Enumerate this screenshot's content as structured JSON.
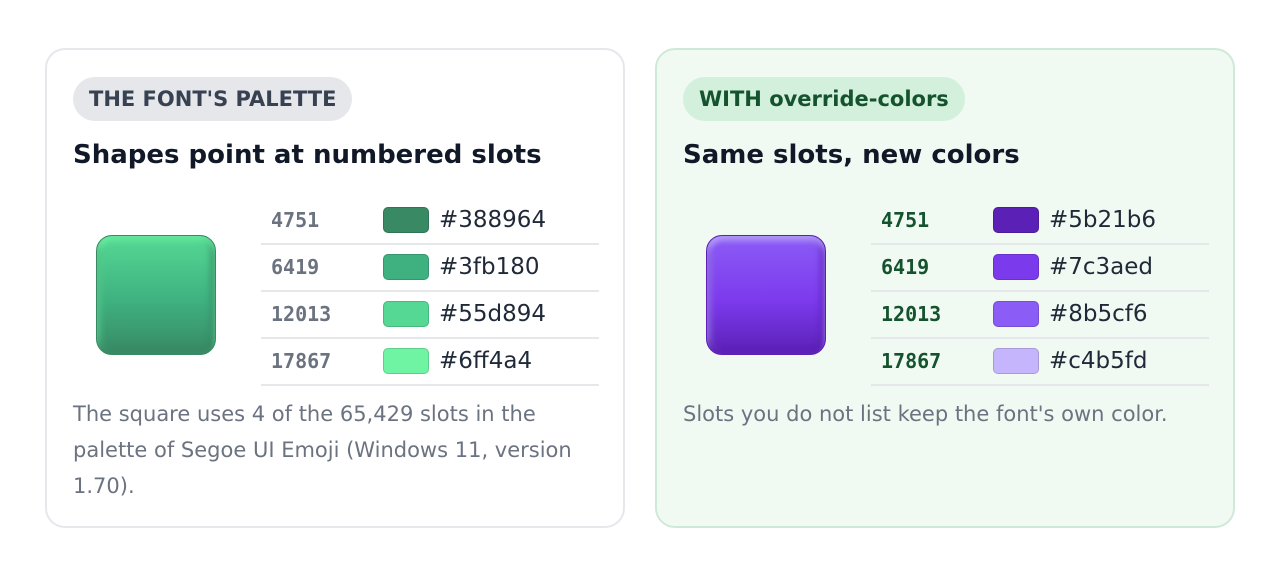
{
  "cards": {
    "original": {
      "badge": "THE FONT'S PALETTE",
      "title": "Shapes point at numbered slots",
      "square_gradient": [
        "#6ff4a4",
        "#55d894",
        "#3fb180",
        "#388964"
      ],
      "slots": [
        {
          "id": "4751",
          "hex": "#388964",
          "color": "#388964"
        },
        {
          "id": "6419",
          "hex": "#3fb180",
          "color": "#3fb180"
        },
        {
          "id": "12013",
          "hex": "#55d894",
          "color": "#55d894"
        },
        {
          "id": "17867",
          "hex": "#6ff4a4",
          "color": "#6ff4a4"
        }
      ],
      "caption": "The square uses 4 of the 65,429 slots in the palette of Segoe UI Emoji (Windows 11, version 1.70)."
    },
    "override": {
      "badge": "WITH override-colors",
      "title": "Same slots, new colors",
      "square_gradient": [
        "#c4b5fd",
        "#8b5cf6",
        "#7c3aed",
        "#5b21b6"
      ],
      "slots": [
        {
          "id": "4751",
          "hex": "#5b21b6",
          "color": "#5b21b6"
        },
        {
          "id": "6419",
          "hex": "#7c3aed",
          "color": "#7c3aed"
        },
        {
          "id": "12013",
          "hex": "#8b5cf6",
          "color": "#8b5cf6"
        },
        {
          "id": "17867",
          "hex": "#c4b5fd",
          "color": "#c4b5fd"
        }
      ],
      "caption": "Slots you do not list keep the font's own color."
    }
  }
}
